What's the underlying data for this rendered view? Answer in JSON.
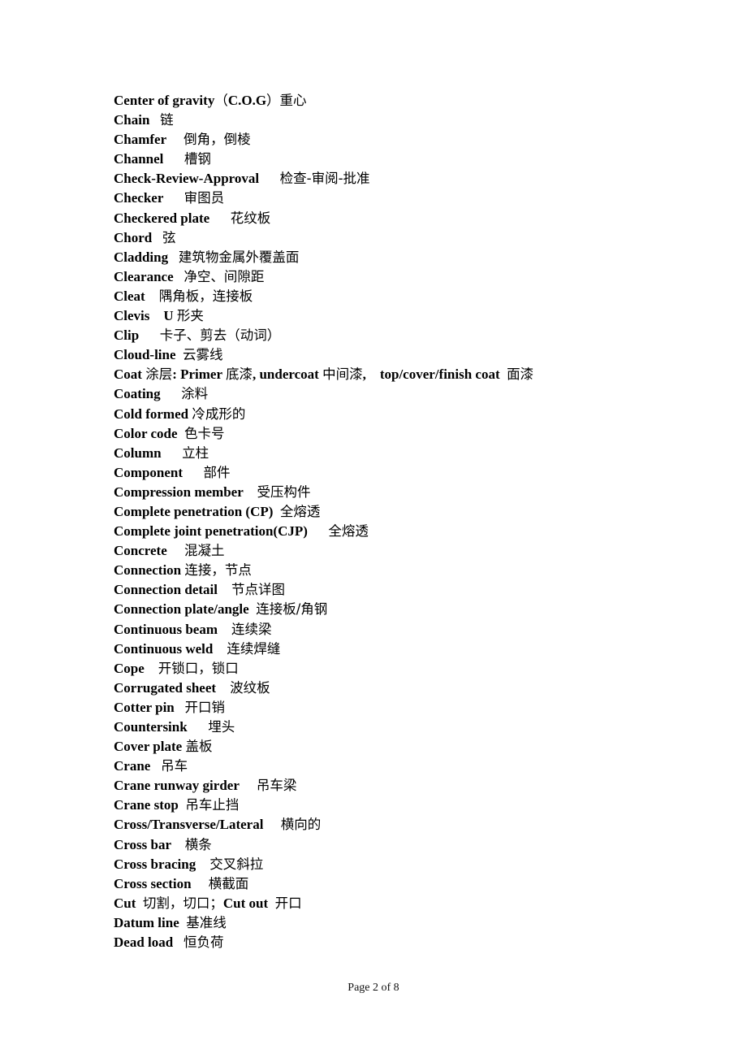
{
  "document": {
    "entries": [
      {
        "segments": [
          {
            "t": "Center of gravity",
            "k": "en"
          },
          {
            "t": "（",
            "k": "zh"
          },
          {
            "t": "C.O.G",
            "k": "en"
          },
          {
            "t": "）重心",
            "k": "zh"
          }
        ]
      },
      {
        "segments": [
          {
            "t": "Chain   ",
            "k": "en"
          },
          {
            "t": "链",
            "k": "zh"
          }
        ]
      },
      {
        "segments": [
          {
            "t": "Chamfer     ",
            "k": "en"
          },
          {
            "t": "倒角，倒棱",
            "k": "zh"
          }
        ]
      },
      {
        "segments": [
          {
            "t": "Channel      ",
            "k": "en"
          },
          {
            "t": "槽钢",
            "k": "zh"
          }
        ]
      },
      {
        "segments": [
          {
            "t": "Check-Review-Approval      ",
            "k": "en"
          },
          {
            "t": "检查-审阅-批准",
            "k": "zh"
          }
        ]
      },
      {
        "segments": [
          {
            "t": "Checker      ",
            "k": "en"
          },
          {
            "t": "审图员",
            "k": "zh"
          }
        ]
      },
      {
        "segments": [
          {
            "t": "Checkered plate      ",
            "k": "en"
          },
          {
            "t": "花纹板",
            "k": "zh"
          }
        ]
      },
      {
        "segments": [
          {
            "t": "Chord   ",
            "k": "en"
          },
          {
            "t": "弦",
            "k": "zh"
          }
        ]
      },
      {
        "segments": [
          {
            "t": "Cladding   ",
            "k": "en"
          },
          {
            "t": "建筑物金属外覆盖面",
            "k": "zh"
          }
        ]
      },
      {
        "segments": [
          {
            "t": "Clearance   ",
            "k": "en"
          },
          {
            "t": "净空、间隙距",
            "k": "zh"
          }
        ]
      },
      {
        "segments": [
          {
            "t": "Cleat    ",
            "k": "en"
          },
          {
            "t": "隅角板，连接板",
            "k": "zh"
          }
        ]
      },
      {
        "segments": [
          {
            "t": "Clevis    U ",
            "k": "en"
          },
          {
            "t": "形夹",
            "k": "zh"
          }
        ]
      },
      {
        "segments": [
          {
            "t": "Clip      ",
            "k": "en"
          },
          {
            "t": "卡子、剪去（动词）",
            "k": "zh"
          }
        ]
      },
      {
        "segments": [
          {
            "t": "Cloud-line  ",
            "k": "en"
          },
          {
            "t": "云雾线",
            "k": "zh"
          }
        ]
      },
      {
        "segments": [
          {
            "t": "Coat ",
            "k": "en"
          },
          {
            "t": "涂层",
            "k": "zh"
          },
          {
            "t": ": Primer ",
            "k": "en"
          },
          {
            "t": "底漆",
            "k": "zh"
          },
          {
            "t": ", undercoat ",
            "k": "en"
          },
          {
            "t": "中间漆",
            "k": "zh"
          },
          {
            "t": ",    top/cover/finish coat  ",
            "k": "en"
          },
          {
            "t": "面漆",
            "k": "zh"
          }
        ]
      },
      {
        "segments": [
          {
            "t": "Coating      ",
            "k": "en"
          },
          {
            "t": "涂料",
            "k": "zh"
          }
        ]
      },
      {
        "segments": [
          {
            "t": "Cold formed ",
            "k": "en"
          },
          {
            "t": "冷成形的",
            "k": "zh"
          }
        ]
      },
      {
        "segments": [
          {
            "t": "Color code  ",
            "k": "en"
          },
          {
            "t": "色卡号",
            "k": "zh"
          }
        ]
      },
      {
        "segments": [
          {
            "t": "Column      ",
            "k": "en"
          },
          {
            "t": "立柱",
            "k": "zh"
          }
        ]
      },
      {
        "segments": [
          {
            "t": "Component      ",
            "k": "en"
          },
          {
            "t": "部件",
            "k": "zh"
          }
        ]
      },
      {
        "segments": [
          {
            "t": "Compression member    ",
            "k": "en"
          },
          {
            "t": "受压构件",
            "k": "zh"
          }
        ]
      },
      {
        "segments": [
          {
            "t": "Complete penetration (CP)  ",
            "k": "en"
          },
          {
            "t": "全熔透",
            "k": "zh"
          }
        ]
      },
      {
        "segments": [
          {
            "t": "Complete joint penetration(CJP)      ",
            "k": "en"
          },
          {
            "t": "全熔透",
            "k": "zh"
          }
        ]
      },
      {
        "segments": [
          {
            "t": "Concrete     ",
            "k": "en"
          },
          {
            "t": "混凝土",
            "k": "zh"
          }
        ]
      },
      {
        "segments": [
          {
            "t": "Connection ",
            "k": "en"
          },
          {
            "t": "连接，节点",
            "k": "zh"
          }
        ]
      },
      {
        "segments": [
          {
            "t": "Connection detail    ",
            "k": "en"
          },
          {
            "t": "节点详图",
            "k": "zh"
          }
        ]
      },
      {
        "segments": [
          {
            "t": "Connection plate/angle  ",
            "k": "en"
          },
          {
            "t": "连接板/角钢",
            "k": "zh"
          }
        ]
      },
      {
        "segments": [
          {
            "t": "Continuous beam    ",
            "k": "en"
          },
          {
            "t": "连续梁",
            "k": "zh"
          }
        ]
      },
      {
        "segments": [
          {
            "t": "Continuous weld    ",
            "k": "en"
          },
          {
            "t": "连续焊缝",
            "k": "zh"
          }
        ]
      },
      {
        "segments": [
          {
            "t": "Cope    ",
            "k": "en"
          },
          {
            "t": "开锁口，锁口",
            "k": "zh"
          }
        ]
      },
      {
        "segments": [
          {
            "t": "Corrugated sheet    ",
            "k": "en"
          },
          {
            "t": "波纹板",
            "k": "zh"
          }
        ]
      },
      {
        "segments": [
          {
            "t": "Cotter pin   ",
            "k": "en"
          },
          {
            "t": "开口销",
            "k": "zh"
          }
        ]
      },
      {
        "segments": [
          {
            "t": "Countersink      ",
            "k": "en"
          },
          {
            "t": "埋头",
            "k": "zh"
          }
        ]
      },
      {
        "segments": [
          {
            "t": "Cover plate ",
            "k": "en"
          },
          {
            "t": "盖板",
            "k": "zh"
          }
        ]
      },
      {
        "segments": [
          {
            "t": "Crane   ",
            "k": "en"
          },
          {
            "t": "吊车",
            "k": "zh"
          }
        ]
      },
      {
        "segments": [
          {
            "t": "Crane runway girder     ",
            "k": "en"
          },
          {
            "t": "吊车梁",
            "k": "zh"
          }
        ]
      },
      {
        "segments": [
          {
            "t": "Crane stop  ",
            "k": "en"
          },
          {
            "t": "吊车止挡",
            "k": "zh"
          }
        ]
      },
      {
        "segments": [
          {
            "t": "Cross/Transverse/Lateral     ",
            "k": "en"
          },
          {
            "t": "横向的",
            "k": "zh"
          }
        ]
      },
      {
        "segments": [
          {
            "t": "Cross bar    ",
            "k": "en"
          },
          {
            "t": "横条",
            "k": "zh"
          }
        ]
      },
      {
        "segments": [
          {
            "t": "Cross bracing    ",
            "k": "en"
          },
          {
            "t": "交叉斜拉",
            "k": "zh"
          }
        ]
      },
      {
        "segments": [
          {
            "t": "Cross section     ",
            "k": "en"
          },
          {
            "t": "横截面",
            "k": "zh"
          }
        ]
      },
      {
        "segments": [
          {
            "t": "Cut  ",
            "k": "en"
          },
          {
            "t": "切割，切口；",
            "k": "zh"
          },
          {
            "t": "Cut out  ",
            "k": "en"
          },
          {
            "t": "开口",
            "k": "zh"
          }
        ]
      },
      {
        "segments": [
          {
            "t": "Datum line  ",
            "k": "en"
          },
          {
            "t": "基准线",
            "k": "zh"
          }
        ]
      },
      {
        "segments": [
          {
            "t": "Dead load   ",
            "k": "en"
          },
          {
            "t": "恒负荷",
            "k": "zh"
          }
        ]
      }
    ],
    "footer": "Page 2 of 8"
  }
}
